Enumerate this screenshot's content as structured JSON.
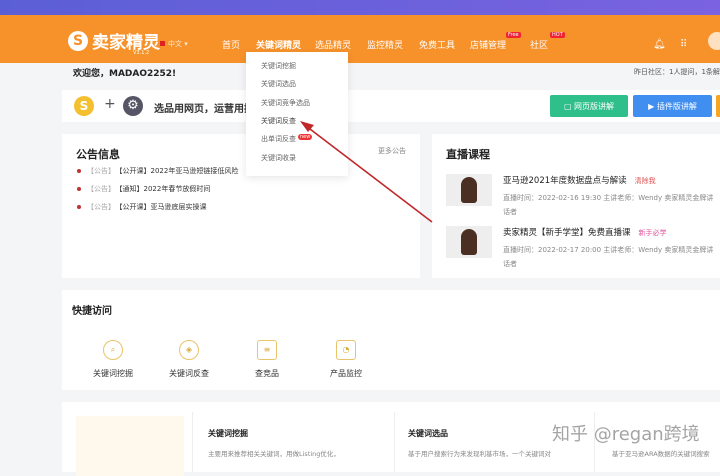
{
  "header": {
    "logo": "卖家精灵",
    "logo_mark": "S",
    "version": "V3.1.2",
    "lang": "中文",
    "nav": [
      {
        "label": "首页"
      },
      {
        "label": "关键词精灵"
      },
      {
        "label": "选品精灵"
      },
      {
        "label": "监控精灵"
      },
      {
        "label": "免费工具"
      },
      {
        "label": "店铺管理",
        "badge": "Free"
      },
      {
        "label": "社区",
        "badge": "HOT"
      }
    ]
  },
  "dropdown": {
    "items": [
      "关键词挖掘",
      "关键词选品",
      "关键词竞争选品",
      "关键词反查",
      "出单词反查",
      "关键词收录"
    ],
    "new_badge": "new"
  },
  "welcome": "欢迎您，MADAO2252!",
  "yesterday": "昨日社区：1人提问，1条解",
  "banner": {
    "text": "选品用网页，运营用插",
    "btn_web": "网页版讲解",
    "btn_plugin": "插件版讲解"
  },
  "announcements": {
    "title": "公告信息",
    "more": "更多公告",
    "items": [
      {
        "tag": "【公告】",
        "text": "【公开课】2022年亚马逊短链接低风险"
      },
      {
        "tag": "【公告】",
        "text": "【通知】2022年春节放假时间"
      },
      {
        "tag": "【公告】",
        "text": "【公开课】亚马逊底层实操课"
      }
    ]
  },
  "live": {
    "title": "直播课程",
    "items": [
      {
        "title": "亚马逊2021年度数据盘点与解读",
        "tag": "清除我",
        "meta": "直播时间：2022-02-16 19:30   主讲老师：Wendy 卖家精灵金牌讲",
        "meta2": "话者"
      },
      {
        "title": "卖家精灵【新手学堂】免费直播课",
        "tag": "新手必学",
        "meta": "直播时间：2022-02-17 20:00   主讲老师：Wendy 卖家精灵金牌讲",
        "meta2": "话者"
      }
    ]
  },
  "quick": {
    "title": "快捷访问",
    "items": [
      "关键词挖掘",
      "关键词反查",
      "查竞品",
      "产品监控"
    ]
  },
  "features": [
    {
      "title": "关键词挖掘",
      "desc": "主要用来推荐相关关键词，用做Listing优化，"
    },
    {
      "title": "关键词选品",
      "desc": "基于用户搜索行为来发现利基市场，一个关键词对"
    },
    {
      "title": "",
      "desc": "基于亚马逊ARA数据的关键词搜索"
    }
  ],
  "watermark": "知乎 @regan跨境",
  "colors": {
    "orange": "#f7922b",
    "green": "#2fbf8a",
    "blue": "#3f8ef0"
  }
}
